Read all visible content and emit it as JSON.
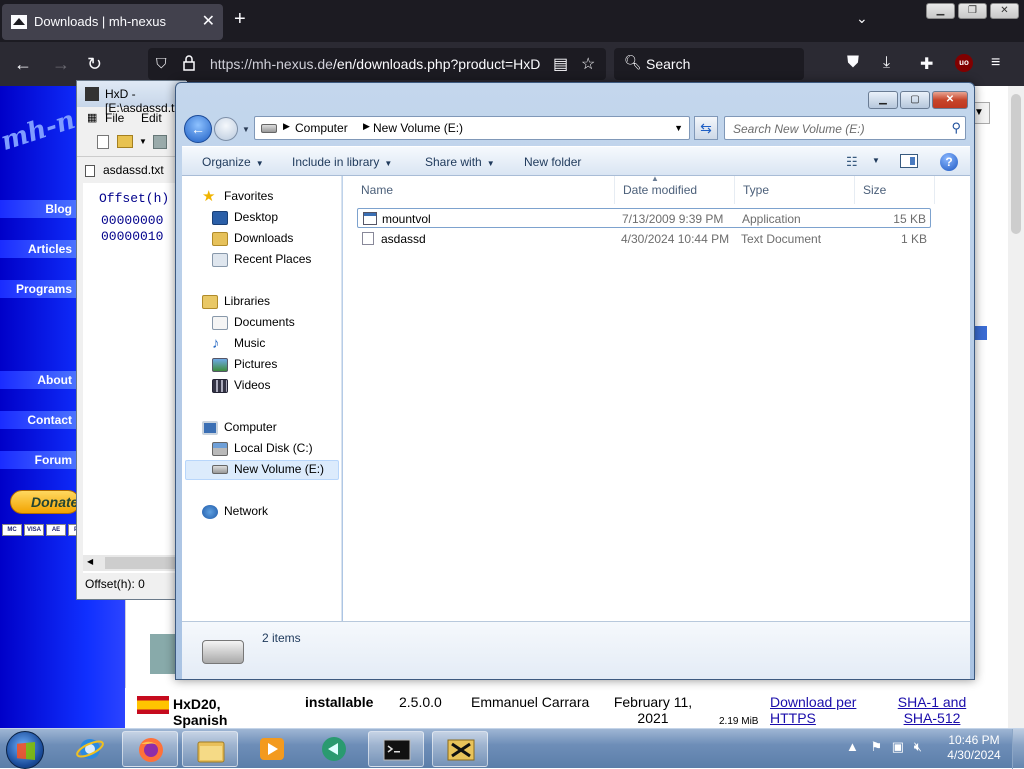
{
  "browser": {
    "tab_title": "Downloads | mh-nexus",
    "tab_close": "✕",
    "new_tab": "+",
    "list_tabs": "⌄",
    "url_host": "https://mh-nexus.de",
    "url_path": "/en/downloads.php?product=HxD",
    "search_label": "Search",
    "ublock_label": "uo"
  },
  "website": {
    "logo": "mh-n",
    "nav": [
      "Blog",
      "Articles",
      "Programs",
      "About",
      "Contact",
      "Forum"
    ],
    "donate": "Donate",
    "cards": [
      "MC",
      "VISA",
      "AE",
      "PP"
    ],
    "download_row": {
      "name": "HxD20, Spanish",
      "type": "installable",
      "version": "2.5.0.0",
      "author": "Emmanuel Carrara",
      "date": "February 11, 2021",
      "size": "2.19 MiB",
      "download_link": "Download per HTTPS",
      "hash_link": "SHA-1 and SHA-512"
    }
  },
  "hxd": {
    "title": "HxD - [E:\\asdassd.txt]",
    "menu": [
      "File",
      "Edit"
    ],
    "file_tab": "asdassd.txt",
    "offset_header": "Offset(h)",
    "offsets": [
      "00000000",
      "00000010"
    ],
    "status": "Offset(h): 0"
  },
  "explorer": {
    "breadcrumb": [
      "Computer",
      "New Volume (E:)"
    ],
    "search_placeholder": "Search New Volume (E:)",
    "toolbar": [
      "Organize",
      "Include in library",
      "Share with",
      "New folder"
    ],
    "nav": {
      "favorites": "Favorites",
      "favorites_items": [
        "Desktop",
        "Downloads",
        "Recent Places"
      ],
      "libraries": "Libraries",
      "libraries_items": [
        "Documents",
        "Music",
        "Pictures",
        "Videos"
      ],
      "computer": "Computer",
      "computer_items": [
        "Local Disk (C:)",
        "New Volume (E:)"
      ],
      "network": "Network"
    },
    "columns": [
      "Name",
      "Date modified",
      "Type",
      "Size"
    ],
    "files": [
      {
        "name": "mountvol",
        "date": "7/13/2009 9:39 PM",
        "type": "Application",
        "size": "15 KB"
      },
      {
        "name": "asdassd",
        "date": "4/30/2024 10:44 PM",
        "type": "Text Document",
        "size": "1 KB"
      }
    ],
    "details_count": "2 items"
  },
  "taskbar": {
    "time": "10:46 PM",
    "date": "4/30/2024"
  }
}
